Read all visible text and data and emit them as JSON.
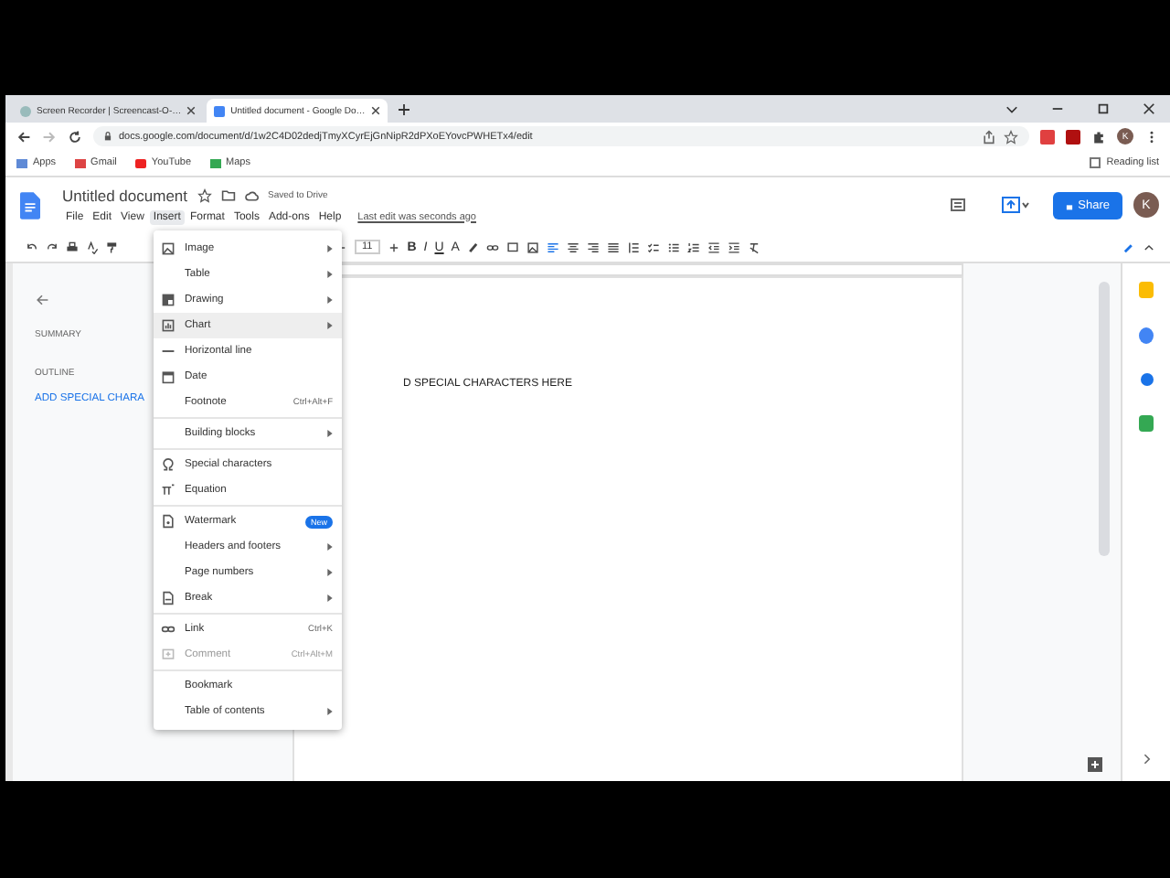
{
  "browser": {
    "tabs": [
      {
        "title": "Screen Recorder | Screencast-O-…",
        "selected": false
      },
      {
        "title": "Untitled document - Google Do…",
        "selected": true
      }
    ],
    "address": "docs.google.com/document/d/1w2C4D02dedjTmyXCyrEjGnNipR2dPXoEYovcPWHETx4/edit",
    "bookmarks": [
      "Apps",
      "Gmail",
      "YouTube",
      "Maps"
    ],
    "reading_list": "Reading list",
    "profile": "K"
  },
  "docs": {
    "title": "Untitled document",
    "saved": "Saved to Drive",
    "menus": [
      {
        "label": "File",
        "selected": false
      },
      {
        "label": "Edit",
        "selected": false
      },
      {
        "label": "View",
        "selected": false
      },
      {
        "label": "Insert",
        "selected": true
      },
      {
        "label": "Format",
        "selected": false
      },
      {
        "label": "Tools",
        "selected": false
      },
      {
        "label": "Add-ons",
        "selected": false
      },
      {
        "label": "Help",
        "selected": false
      }
    ],
    "last_edit": "Last edit was seconds ago",
    "share": "Share",
    "avatar": "K",
    "font_size": "11",
    "format_buttons": [
      "B",
      "I",
      "U",
      "A"
    ]
  },
  "outline": {
    "summary": "SUMMARY",
    "outline": "OUTLINE",
    "heading": "ADD SPECIAL CHARA"
  },
  "document_text": "D SPECIAL CHARACTERS HERE",
  "insert_menu": [
    [
      {
        "label": "Image",
        "kind": "image",
        "submenu": true,
        "highlighted": false,
        "disabled": false
      },
      {
        "label": "Table",
        "kind": "plain",
        "submenu": true,
        "highlighted": false,
        "disabled": false
      },
      {
        "label": "Drawing",
        "kind": "drawing",
        "submenu": true,
        "highlighted": false,
        "disabled": false
      },
      {
        "label": "Chart",
        "kind": "chart",
        "submenu": true,
        "highlighted": true,
        "disabled": false
      },
      {
        "label": "Horizontal line",
        "kind": "line",
        "submenu": false,
        "highlighted": false,
        "disabled": false
      },
      {
        "label": "Date",
        "kind": "date",
        "submenu": false,
        "highlighted": false,
        "disabled": false
      },
      {
        "label": "Footnote",
        "kind": "plain",
        "shortcut": "Ctrl+Alt+F",
        "submenu": false,
        "highlighted": false,
        "disabled": false
      }
    ],
    [
      {
        "label": "Building blocks",
        "kind": "plain",
        "submenu": true,
        "highlighted": false,
        "disabled": false
      }
    ],
    [
      {
        "label": "Special characters",
        "kind": "omega",
        "submenu": false,
        "highlighted": false,
        "disabled": false
      },
      {
        "label": "Equation",
        "kind": "pi",
        "submenu": false,
        "highlighted": false,
        "disabled": false
      }
    ],
    [
      {
        "label": "Watermark",
        "kind": "watermark",
        "badge": "New",
        "submenu": false,
        "highlighted": false,
        "disabled": false
      },
      {
        "label": "Headers and footers",
        "kind": "plain",
        "submenu": true,
        "highlighted": false,
        "disabled": false
      },
      {
        "label": "Page numbers",
        "kind": "plain",
        "submenu": true,
        "highlighted": false,
        "disabled": false
      },
      {
        "label": "Break",
        "kind": "break",
        "submenu": true,
        "highlighted": false,
        "disabled": false
      }
    ],
    [
      {
        "label": "Link",
        "kind": "link",
        "shortcut": "Ctrl+K",
        "submenu": false,
        "highlighted": false,
        "disabled": false
      },
      {
        "label": "Comment",
        "kind": "comment",
        "shortcut": "Ctrl+Alt+M",
        "submenu": false,
        "highlighted": false,
        "disabled": true
      }
    ],
    [
      {
        "label": "Bookmark",
        "kind": "plain",
        "submenu": false,
        "highlighted": false,
        "disabled": false
      },
      {
        "label": "Table of contents",
        "kind": "plain",
        "submenu": true,
        "highlighted": false,
        "disabled": false
      }
    ]
  ]
}
